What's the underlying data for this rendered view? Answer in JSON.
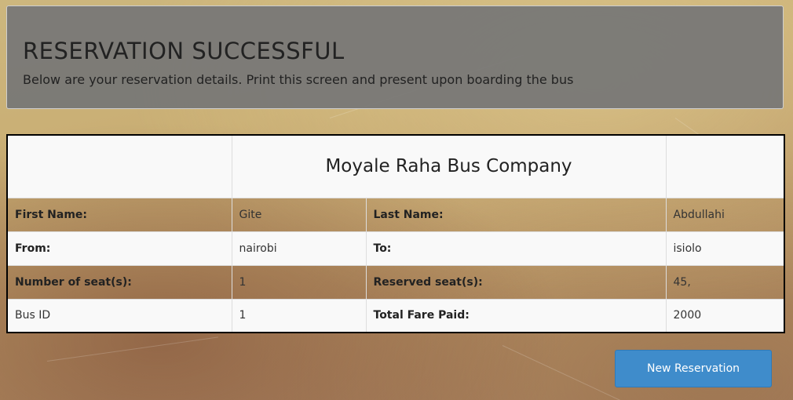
{
  "banner": {
    "title": "RESERVATION SUCCESSFUL",
    "subtitle": "Below are your reservation details. Print this screen and present upon boarding the bus"
  },
  "reservation": {
    "company": "Moyale Raha Bus Company",
    "rows": [
      {
        "label1": "First Name:",
        "value1": "Gite",
        "label2": "Last Name:",
        "value2": "Abdullahi"
      },
      {
        "label1": "From:",
        "value1": "nairobi",
        "label2": "To:",
        "value2": "isiolo"
      },
      {
        "label1": "Number of seat(s):",
        "value1": "1",
        "label2": "Reserved seat(s):",
        "value2": "45,"
      },
      {
        "label1": "Bus ID",
        "value1": "1",
        "label2": "Total Fare Paid:",
        "value2": "2000"
      }
    ]
  },
  "actions": {
    "new_reservation_label": "New Reservation"
  }
}
